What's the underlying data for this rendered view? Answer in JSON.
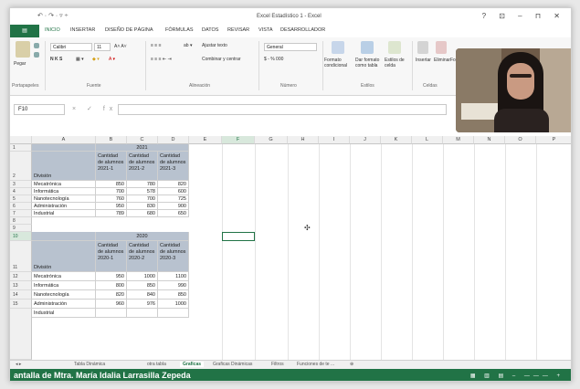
{
  "window": {
    "title": "Excel Estadístico 1 - Excel",
    "controls": "? ⊡ – ⊓ ✕"
  },
  "quick_access": "↶ · ↷ · ▿ ÷",
  "tabs": [
    "INICIO",
    "INSERTAR",
    "DISEÑO DE PÁGINA",
    "FÓRMULAS",
    "DATOS",
    "REVISAR",
    "VISTA",
    "DESARROLLADOR"
  ],
  "ribbon": {
    "paste": "Pegar",
    "font_name": "Calibri",
    "font_size": "11",
    "font_styles": "N  K  S",
    "wrap_text": "Ajustar texto",
    "merge_center": "Combinar y centrar",
    "number_format": "General",
    "number_symbols": "$ - % 000",
    "conditional_format": "Formato condicional",
    "format_as_table": "Dar formato como tabla",
    "cell_styles": "Estilos de celda",
    "insert": "Insertar",
    "delete": "Eliminar",
    "format": "Forma",
    "groups": [
      "Portapapeles",
      "Fuente",
      "Alineación",
      "Número",
      "Estilos",
      "Celdas"
    ]
  },
  "formula_bar": {
    "name_box": "F10",
    "icons": "×  ✓  fx",
    "value": ""
  },
  "columns": [
    "A",
    "B",
    "C",
    "D",
    "E",
    "F",
    "G",
    "H",
    "I",
    "J",
    "K",
    "L",
    "M",
    "N",
    "O",
    "P"
  ],
  "selected_cell": "F10",
  "rows": [
    {
      "n": "1"
    },
    {
      "n": "2"
    },
    {
      "n": "3"
    },
    {
      "n": "4"
    },
    {
      "n": "5"
    },
    {
      "n": "6"
    },
    {
      "n": "7"
    },
    {
      "n": "8"
    },
    {
      "n": "9"
    },
    {
      "n": "10"
    },
    {
      "n": "11"
    },
    {
      "n": "12"
    },
    {
      "n": "13"
    },
    {
      "n": "14"
    },
    {
      "n": "15"
    }
  ],
  "table_2021": {
    "year": "2021",
    "header_division": "División",
    "headers": [
      "Cantidad de alumnos 2021-1",
      "Cantidad de alumnos 2021-2",
      "Cantidad de alumnos 2021-3"
    ],
    "rows": [
      {
        "division": "Mecatrónica",
        "v": [
          "850",
          "780",
          "820"
        ]
      },
      {
        "division": "Informática",
        "v": [
          "700",
          "578",
          "600"
        ]
      },
      {
        "division": "Nanotecnología",
        "v": [
          "760",
          "700",
          "725"
        ]
      },
      {
        "division": "Administración",
        "v": [
          "950",
          "830",
          "900"
        ]
      },
      {
        "division": "Industrial",
        "v": [
          "789",
          "680",
          "650"
        ]
      }
    ]
  },
  "table_2020": {
    "year": "2020",
    "header_division": "División",
    "headers": [
      "Cantidad de alumnos 2020-1",
      "Cantidad de alumnos 2020-2",
      "Cantidad de alumnos 2020-3"
    ],
    "rows": [
      {
        "division": "Mecatrónica",
        "v": [
          "950",
          "1000",
          "1100"
        ]
      },
      {
        "division": "Informática",
        "v": [
          "800",
          "850",
          "990"
        ]
      },
      {
        "division": "Nanotecnología",
        "v": [
          "820",
          "840",
          "850"
        ]
      },
      {
        "division": "Administración",
        "v": [
          "960",
          "976",
          "1000"
        ]
      },
      {
        "division": "Industrial",
        "v": [
          "",
          "",
          ""
        ]
      }
    ]
  },
  "sheet_tabs": [
    "Tabla Dinámica",
    "otra tabla",
    "Graficas",
    "Graficas Dinámicas",
    "Filtros",
    "Funciones de te ..."
  ],
  "active_sheet": "Graficas",
  "caption": "antalla de Mtra. María Idalia Larrasilla Zepeda",
  "status_icons": "▦ ▥ ▤ – ——— +"
}
